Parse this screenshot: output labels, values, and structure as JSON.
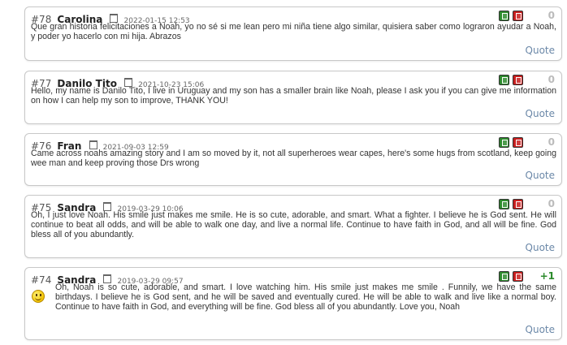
{
  "comments": [
    {
      "number": "#78",
      "author": "Carolina",
      "date": "2022-01-15 12:53",
      "score": "0",
      "text": "Que gran historia felicitaciones a Noah, yo no sé si me lean pero mi niña tiene algo similar, quisiera saber como lograron ayudar a Noah, y poder yo hacerlo con mi hija. Abrazos",
      "quote_label": "Quote"
    },
    {
      "number": "#77",
      "author": "Danilo Tito",
      "date": "2021-10-23 15:06",
      "score": "0",
      "text": "Hello, my name is Danilo Tito, I live in Uruguay and my son has a smaller brain like Noah, please I ask you if you can give me information on how I can help my son to improve, THANK YOU!",
      "quote_label": "Quote"
    },
    {
      "number": "#76",
      "author": "Fran",
      "date": "2021-09-03 12:59",
      "score": "0",
      "text": "Came across noahs amazing story and I am so moved by it, not all superheroes wear capes, here's some hugs from scotland, keep going wee man and keep proving those Drs wrong",
      "quote_label": "Quote"
    },
    {
      "number": "#75",
      "author": "Sandra",
      "date": "2019-03-29 10:06",
      "score": "0",
      "text": "Oh, I just love Noah. His smile just makes me smile. He is so cute, adorable, and smart. What a fighter. I believe he is God sent. He will continue to beat all odds, and will be able to walk one day, and live a normal life. Continue to have faith in God, and all will be fine. God bless all of you abundantly.",
      "quote_label": "Quote"
    },
    {
      "number": "#74",
      "author": "Sandra",
      "date": "2019-03-29 09:57",
      "score": "+1",
      "text": "Oh, Noah is so cute, adorable, and smart. I love watching him. His smile just makes me smile . Funnily, we have the same birthdays. I believe he is God sent, and he will be saved and eventually cured. He will be able to walk and live like a normal boy. Continue to have faith in God, and everything will be fine. God bless all of you abundantly. Love you, Noah",
      "quote_label": "Quote",
      "emoticon": "smiley-icon"
    }
  ],
  "colors": {
    "vote_up": "#2e8b2e",
    "vote_down": "#c81e1e",
    "score_neutral": "#bbbbbb",
    "score_positive": "#2b8a2b",
    "quote_link": "#6b88a8"
  }
}
